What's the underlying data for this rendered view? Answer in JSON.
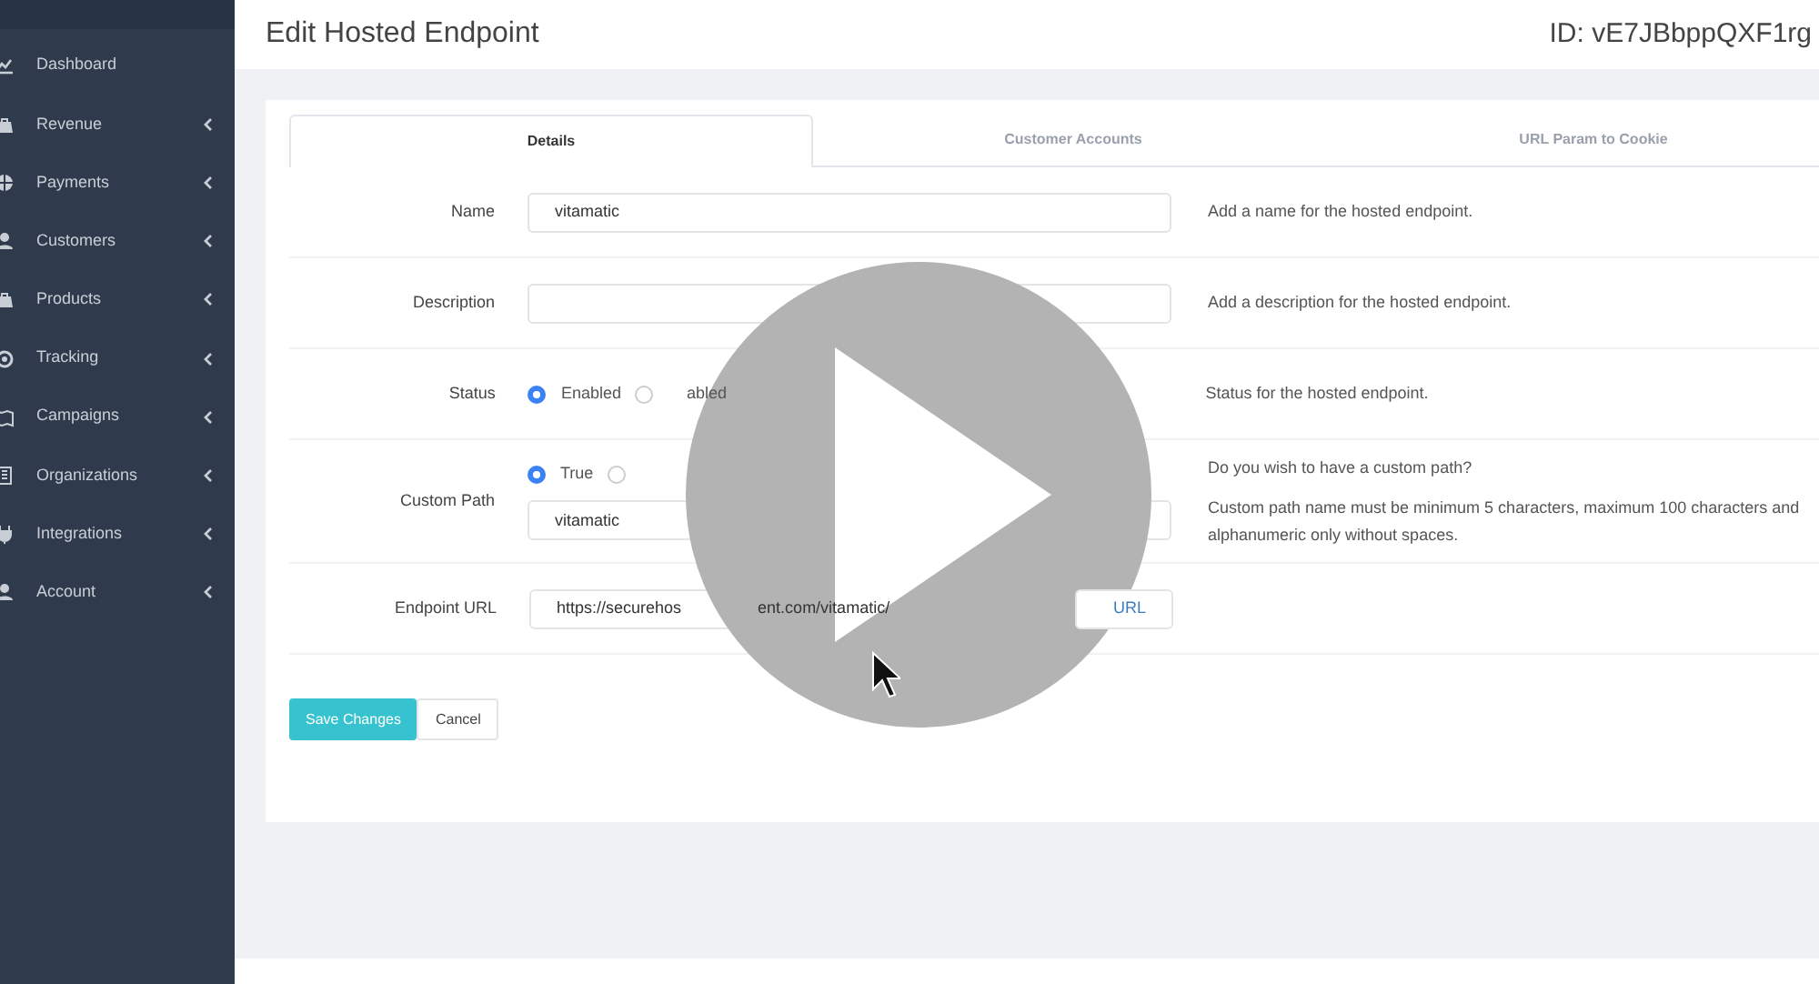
{
  "sidebar": {
    "items": [
      {
        "label": "Dashboard",
        "has_submenu": false
      },
      {
        "label": "Revenue",
        "has_submenu": true
      },
      {
        "label": "Payments",
        "has_submenu": true
      },
      {
        "label": "Customers",
        "has_submenu": true
      },
      {
        "label": "Products",
        "has_submenu": true
      },
      {
        "label": "Tracking",
        "has_submenu": true
      },
      {
        "label": "Campaigns",
        "has_submenu": true
      },
      {
        "label": "Organizations",
        "has_submenu": true
      },
      {
        "label": "Integrations",
        "has_submenu": true
      },
      {
        "label": "Account",
        "has_submenu": true
      }
    ]
  },
  "header": {
    "title": "Edit Hosted Endpoint",
    "id_text": "ID: vE7JBbppQXF1rg"
  },
  "tabs": [
    {
      "label": "Details",
      "selected": true
    },
    {
      "label": "Customer Accounts",
      "selected": false
    },
    {
      "label": "URL Param to Cookie",
      "selected": false
    }
  ],
  "form": {
    "rows": [
      {
        "kind": "text",
        "label": "Name",
        "value": "vitamatic",
        "help": [
          "Add a name for the hosted endpoint."
        ]
      },
      {
        "kind": "text",
        "label": "Description",
        "help": [
          "Add a description for the hosted endpoint."
        ]
      },
      {
        "kind": "radio",
        "label": "Status",
        "options": [
          {
            "label": "Enabled",
            "selected": true
          },
          {
            "label": "abled",
            "selected": false
          }
        ],
        "help": [
          "Status for the hosted endpoint."
        ]
      },
      {
        "kind": "path",
        "label": "Custom Path",
        "options": [
          {
            "label": "True",
            "selected": true
          },
          {
            "selected": false
          }
        ],
        "value": "vitamatic",
        "help": [
          "Do you wish to have a custom path?",
          "Custom path name must be minimum 5 characters, maximum 100 characters and alphanumeric only without spaces."
        ]
      },
      {
        "kind": "url",
        "label": "Endpoint URL",
        "value_parts": [
          "https://securehos",
          "ent.com/vitamatic/"
        ],
        "button": "URL"
      }
    ]
  },
  "buttons": [
    {
      "label": "Save Changes",
      "kind": "primary"
    },
    {
      "label": "Cancel",
      "kind": "secondary"
    }
  ]
}
